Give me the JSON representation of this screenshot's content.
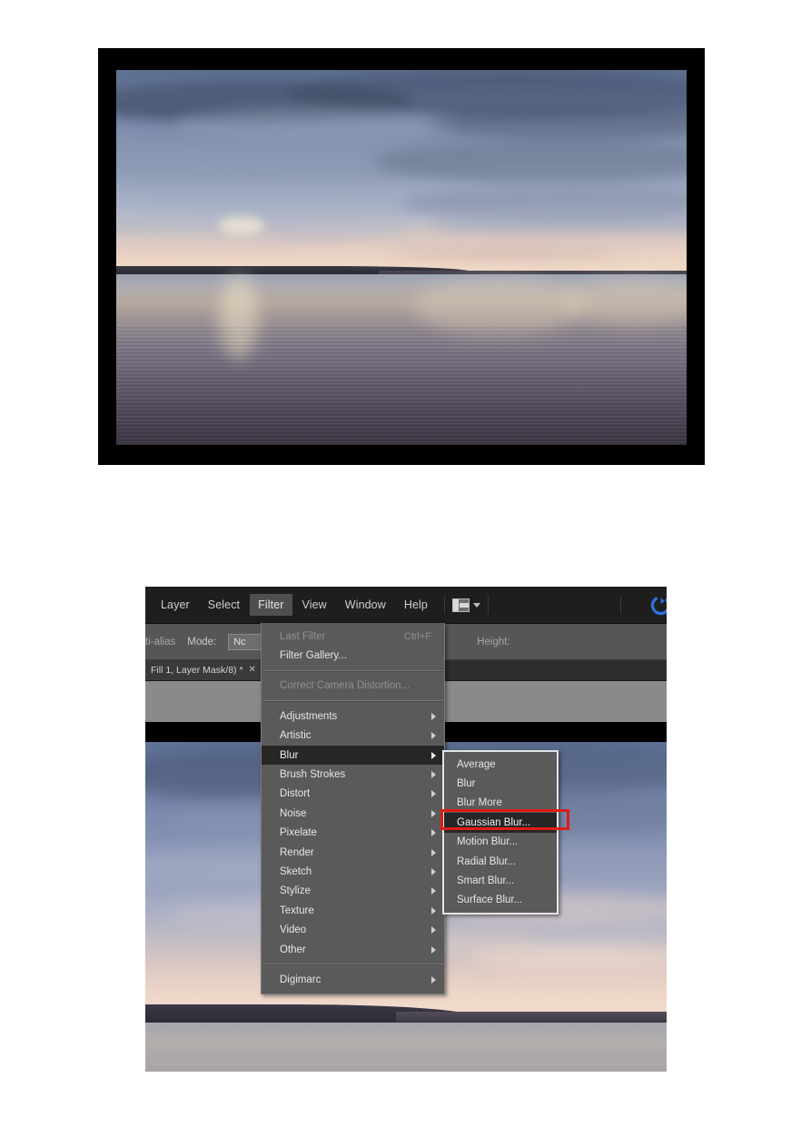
{
  "figure": {
    "photo": {
      "name": "lake-sunset-photograph",
      "description": "Calm lake at dusk with cloudy blue sky, orange horizon glow and rippled water",
      "frame_color": "#000000"
    }
  },
  "screenshot": {
    "app": "Adobe Photoshop",
    "menubar": {
      "items": [
        {
          "label": "Layer",
          "active": false
        },
        {
          "label": "Select",
          "active": false
        },
        {
          "label": "Filter",
          "active": true
        },
        {
          "label": "View",
          "active": false
        },
        {
          "label": "Window",
          "active": false
        },
        {
          "label": "Help",
          "active": false
        }
      ],
      "workspace_switcher": {
        "icon": "workspace-switcher-icon",
        "caret": "chevron-down-icon"
      },
      "cs_live": {
        "icon": "cs-live-refresh-icon",
        "color": "#2f6fd8"
      }
    },
    "optionsbar": {
      "anti_alias_label": "ti-alias",
      "mode_label": "Mode:",
      "mode_value": "Nc",
      "height_label": "Height:"
    },
    "tabbar": {
      "tab_title": "Fill 1, Layer Mask/8) *",
      "close_glyph": "✕"
    },
    "filter_menu": {
      "groups": [
        {
          "items": [
            {
              "label": "Last Filter",
              "shortcut": "Ctrl+F",
              "disabled": true,
              "submenu": false,
              "selected": false
            },
            {
              "label": "Filter Gallery...",
              "shortcut": "",
              "disabled": false,
              "submenu": false,
              "selected": false
            }
          ]
        },
        {
          "items": [
            {
              "label": "Correct Camera Distortion...",
              "shortcut": "",
              "disabled": true,
              "submenu": false,
              "selected": false
            }
          ]
        },
        {
          "items": [
            {
              "label": "Adjustments",
              "shortcut": "",
              "disabled": false,
              "submenu": true,
              "selected": false
            },
            {
              "label": "Artistic",
              "shortcut": "",
              "disabled": false,
              "submenu": true,
              "selected": false
            },
            {
              "label": "Blur",
              "shortcut": "",
              "disabled": false,
              "submenu": true,
              "selected": true
            },
            {
              "label": "Brush Strokes",
              "shortcut": "",
              "disabled": false,
              "submenu": true,
              "selected": false
            },
            {
              "label": "Distort",
              "shortcut": "",
              "disabled": false,
              "submenu": true,
              "selected": false
            },
            {
              "label": "Noise",
              "shortcut": "",
              "disabled": false,
              "submenu": true,
              "selected": false
            },
            {
              "label": "Pixelate",
              "shortcut": "",
              "disabled": false,
              "submenu": true,
              "selected": false
            },
            {
              "label": "Render",
              "shortcut": "",
              "disabled": false,
              "submenu": true,
              "selected": false
            },
            {
              "label": "Sketch",
              "shortcut": "",
              "disabled": false,
              "submenu": true,
              "selected": false
            },
            {
              "label": "Stylize",
              "shortcut": "",
              "disabled": false,
              "submenu": true,
              "selected": false
            },
            {
              "label": "Texture",
              "shortcut": "",
              "disabled": false,
              "submenu": true,
              "selected": false
            },
            {
              "label": "Video",
              "shortcut": "",
              "disabled": false,
              "submenu": true,
              "selected": false
            },
            {
              "label": "Other",
              "shortcut": "",
              "disabled": false,
              "submenu": true,
              "selected": false
            }
          ]
        },
        {
          "items": [
            {
              "label": "Digimarc",
              "shortcut": "",
              "disabled": false,
              "submenu": true,
              "selected": false
            }
          ]
        }
      ]
    },
    "blur_submenu": {
      "items": [
        {
          "label": "Average",
          "selected": false
        },
        {
          "label": "Blur",
          "selected": false
        },
        {
          "label": "Blur More",
          "selected": false
        },
        {
          "label": "Gaussian Blur...",
          "selected": true
        },
        {
          "label": "Motion Blur...",
          "selected": false
        },
        {
          "label": "Radial Blur...",
          "selected": false
        },
        {
          "label": "Smart Blur...",
          "selected": false
        },
        {
          "label": "Surface Blur...",
          "selected": false
        }
      ]
    },
    "annotation": {
      "shape": "rectangle-highlight",
      "color": "#e01b17",
      "targets": "Gaussian Blur..."
    }
  }
}
